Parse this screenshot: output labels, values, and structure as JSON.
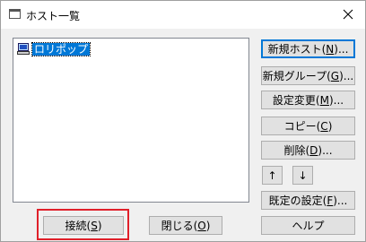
{
  "window": {
    "title": "ホスト一覧",
    "icons": {
      "app": "window-app-icon",
      "close": "close-icon",
      "host": "computer-icon"
    }
  },
  "host_list": {
    "items": [
      {
        "label": "ロリポップ",
        "selected": true
      }
    ]
  },
  "buttons": {
    "new_host": {
      "prefix": "新規ホスト(",
      "key": "N",
      "suffix": ")..."
    },
    "new_group": {
      "prefix": "新規グループ(",
      "key": "G",
      "suffix": ")..."
    },
    "change_settings": {
      "prefix": "設定変更(",
      "key": "M",
      "suffix": ")..."
    },
    "copy": {
      "prefix": "コピー(",
      "key": "C",
      "suffix": ")"
    },
    "delete": {
      "prefix": "削除(",
      "key": "D",
      "suffix": ")..."
    },
    "move_up": "↑",
    "move_down": "↓",
    "default_settings": {
      "prefix": "既定の設定(",
      "key": "F",
      "suffix": ")..."
    },
    "connect": {
      "prefix": "接続(",
      "key": "S",
      "suffix": ")"
    },
    "close": {
      "prefix": "閉じる(",
      "key": "O",
      "suffix": ")"
    },
    "help": "ヘルプ"
  },
  "colors": {
    "selection": "#0078d7",
    "default_button_border": "#0078d7",
    "highlight_box": "#e0202a"
  }
}
